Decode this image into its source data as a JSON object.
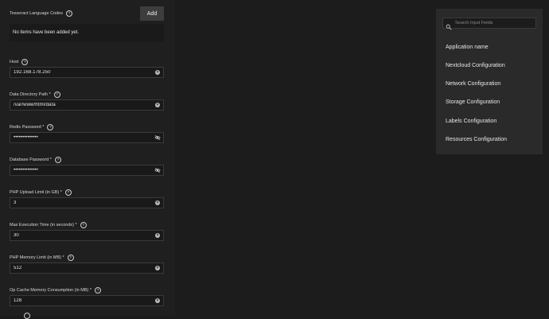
{
  "form": {
    "tesseract": {
      "label": "Tesseract Language Codes",
      "add_label": "Add",
      "empty_text": "No items have been added yet."
    },
    "fields": [
      {
        "label": "Host",
        "value": "192.168.178.250",
        "icon": "clear-icon"
      },
      {
        "label": "Data Directory Path *",
        "value": "/var/www/html/data",
        "icon": "clear-icon"
      },
      {
        "label": "Redis Password *",
        "value": "••••••••••••••",
        "icon": "eye-off-icon"
      },
      {
        "label": "Database Password *",
        "value": "••••••••••••••",
        "icon": "eye-off-icon"
      },
      {
        "label": "PHP Upload Limit (in GB) *",
        "value": "3",
        "icon": "clear-icon"
      },
      {
        "label": "Max Execution Time (in seconds) *",
        "value": "30",
        "icon": "clear-icon"
      },
      {
        "label": "PHP Memory Limit (in MB) *",
        "value": "512",
        "icon": "clear-icon"
      },
      {
        "label": "Op Cache Memory Consumption (in MB) *",
        "value": "128",
        "icon": "clear-icon"
      }
    ]
  },
  "sidebar": {
    "search_placeholder": "Search Input Fields",
    "items": [
      {
        "label": "Application name"
      },
      {
        "label": "Nextcloud Configuration"
      },
      {
        "label": "Network Configuration"
      },
      {
        "label": "Storage Configuration"
      },
      {
        "label": "Labels Configuration"
      },
      {
        "label": "Resources Configuration"
      }
    ]
  },
  "colors": {
    "background": "#1c1c1c",
    "panel": "#2a2a2a",
    "input_bg": "#191919",
    "button_bg": "#3d3d3d"
  }
}
